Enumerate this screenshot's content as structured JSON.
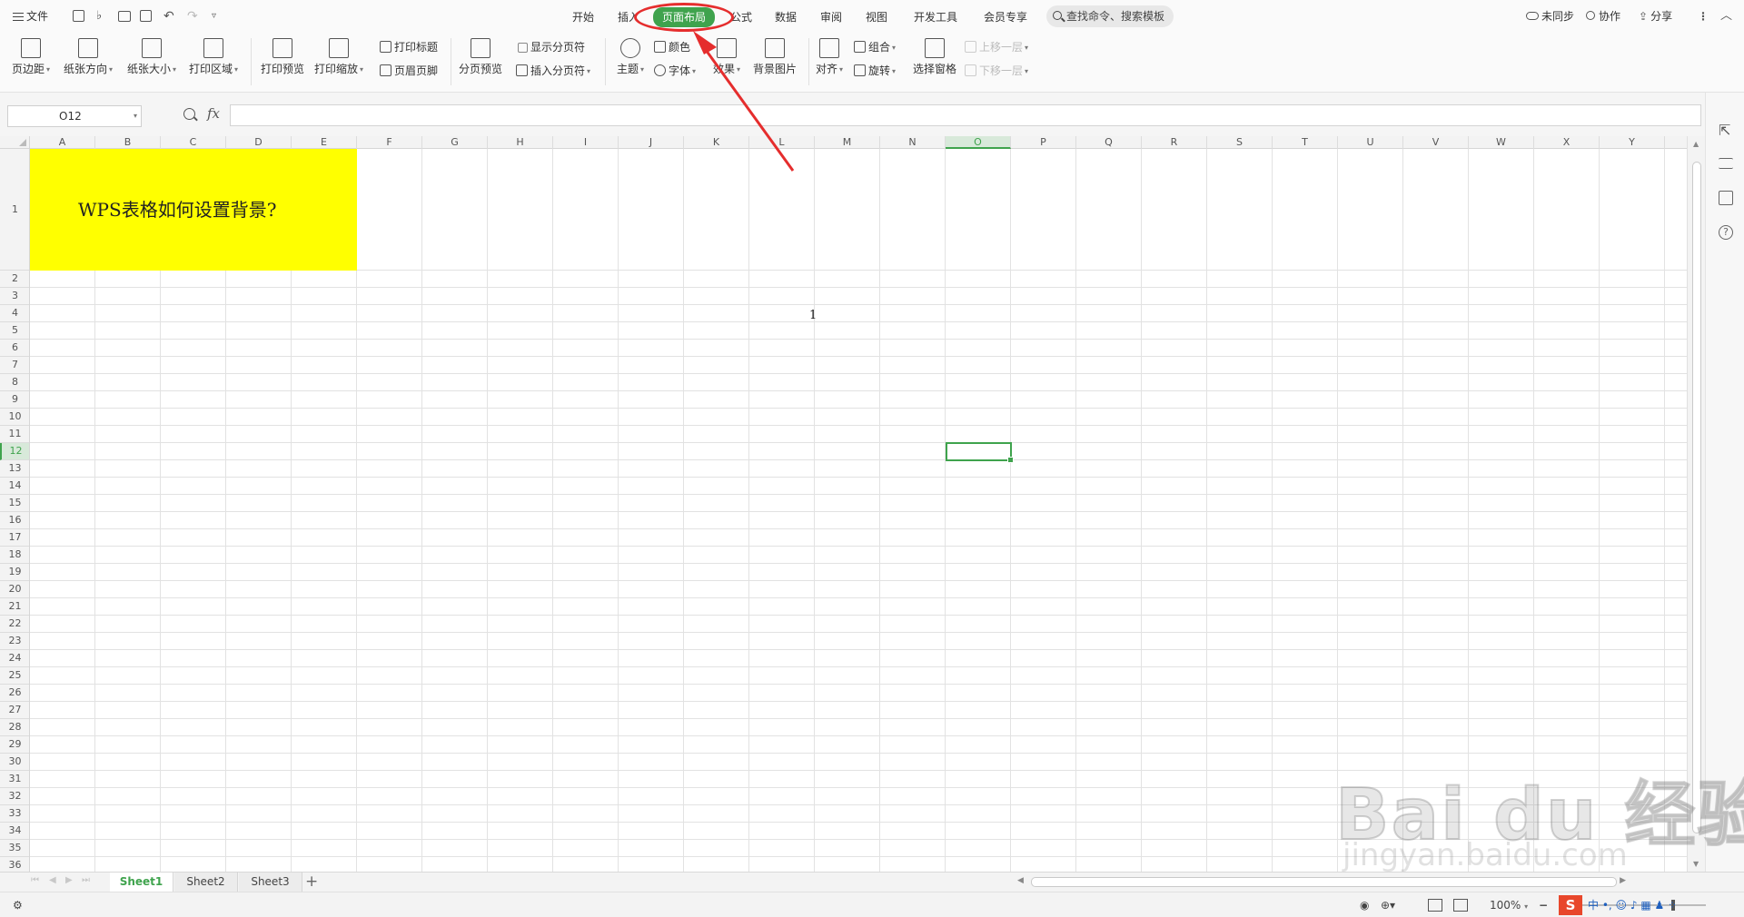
{
  "topbar": {
    "file_menu": "文件",
    "tabs": [
      "开始",
      "插入",
      "页面布局",
      "公式",
      "数据",
      "审阅",
      "视图",
      "开发工具",
      "会员专享"
    ],
    "active_tab": "页面布局",
    "search_label": "查找命令、搜索模板",
    "right": {
      "sync": "未同步",
      "collab": "协作",
      "share": "分享"
    }
  },
  "ribbon": {
    "margins": "页边距",
    "orientation": "纸张方向",
    "size": "纸张大小",
    "print_area": "打印区域",
    "print_preview": "打印预览",
    "print_scale": "打印缩放",
    "print_titles": "打印标题",
    "header_footer": "页眉页脚",
    "page_break_preview": "分页预览",
    "show_page_breaks": "显示分页符",
    "insert_page_break": "插入分页符",
    "theme": "主题",
    "colors": "颜色",
    "fonts": "字体",
    "effects": "效果",
    "background": "背景图片",
    "align": "对齐",
    "group": "组合",
    "rotate": "旋转",
    "selection_pane": "选择窗格",
    "bring_forward": "上移一层",
    "send_backward": "下移一层"
  },
  "formula_bar": {
    "name_box": "O12",
    "fx": "fx",
    "formula": ""
  },
  "grid": {
    "columns": [
      "A",
      "B",
      "C",
      "D",
      "E",
      "F",
      "G",
      "H",
      "I",
      "J",
      "K",
      "L",
      "M",
      "N",
      "O",
      "P",
      "Q",
      "R",
      "S",
      "T",
      "U",
      "V",
      "W",
      "X",
      "Y"
    ],
    "selected_column": "O",
    "rows": [
      "1",
      "2",
      "3",
      "4",
      "5",
      "6",
      "7",
      "8",
      "9",
      "10",
      "11",
      "12",
      "13",
      "14",
      "15",
      "16",
      "17",
      "18",
      "19",
      "20",
      "21",
      "22",
      "23",
      "24",
      "25",
      "26",
      "27",
      "28",
      "29",
      "30",
      "31",
      "32",
      "33",
      "34",
      "35",
      "36"
    ],
    "selected_row": "12",
    "title_cell_text": "WPS表格如何设置背景?",
    "title_cell_color": "#ffff00",
    "cell_l4_value": "1"
  },
  "sheets": {
    "tabs": [
      "Sheet1",
      "Sheet2",
      "Sheet3"
    ],
    "active": "Sheet1"
  },
  "status": {
    "zoom": "100%"
  },
  "watermark": {
    "logo": "Bai du 经验",
    "url": "jingyan.baidu.com"
  },
  "colors": {
    "accent": "#3fa34d",
    "annotation": "#e52d2d"
  }
}
